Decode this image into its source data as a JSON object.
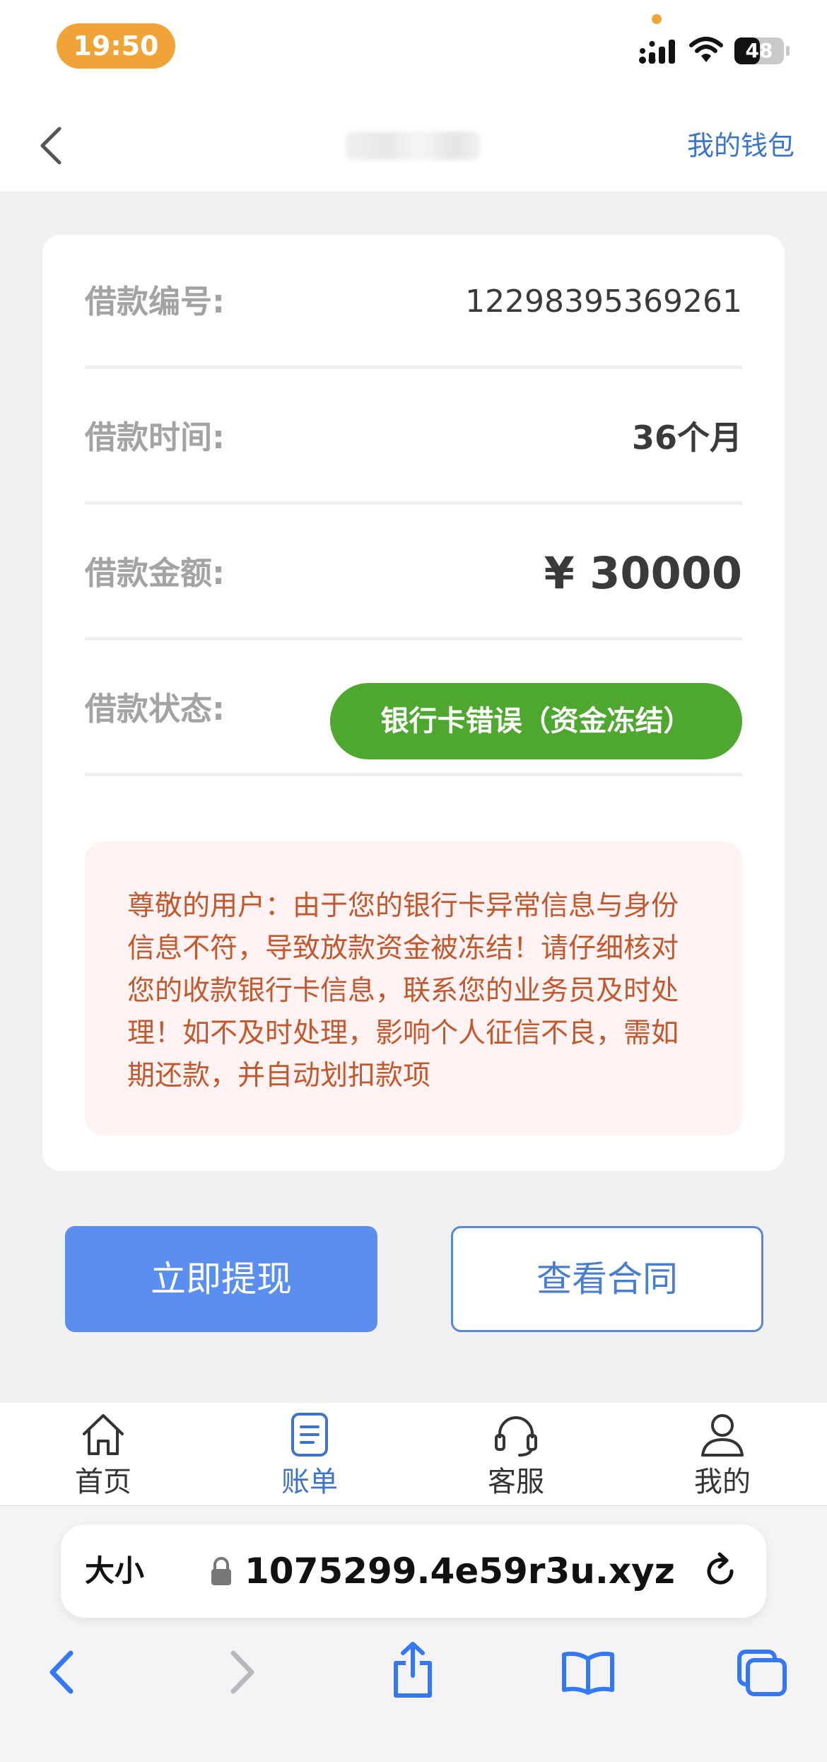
{
  "status_bar": {
    "time": "19:50",
    "battery": "48"
  },
  "nav": {
    "wallet_label": "我的钱包"
  },
  "loan": {
    "rows": [
      {
        "label": "借款编号:",
        "value": "12298395369261"
      },
      {
        "label": "借款时间:",
        "value": "36个月"
      },
      {
        "label": "借款金额:",
        "value": "¥ 30000"
      },
      {
        "label": "借款状态:",
        "value": "银行卡错误（资金冻结）"
      }
    ],
    "notice": "尊敬的用户：由于您的银行卡异常信息与身份信息不符，导致放款资金被冻结！请仔细核对您的收款银行卡信息，联系您的业务员及时处理！如不及时处理，影响个人征信不良，需如期还款，并自动划扣款项"
  },
  "actions": {
    "withdraw_label": "立即提现",
    "contract_label": "查看合同"
  },
  "tabs": [
    {
      "label": "首页",
      "icon": "home-icon"
    },
    {
      "label": "账单",
      "icon": "bill-icon",
      "active": true
    },
    {
      "label": "客服",
      "icon": "headset-icon"
    },
    {
      "label": "我的",
      "icon": "user-icon"
    }
  ],
  "browser": {
    "text_size_label": "大小",
    "url": "1075299.4e59r3u.xyz"
  },
  "colors": {
    "accent": "#3d74c9",
    "status_green": "#4ea82f",
    "primary_button": "#5a8ff0",
    "notice_text": "#c2582e",
    "notice_bg": "#fff2f2",
    "time_pill": "#f0a437"
  }
}
